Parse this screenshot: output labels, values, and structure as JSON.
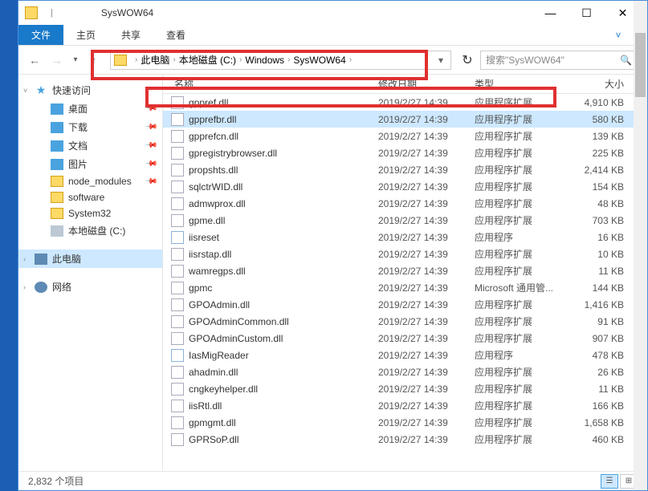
{
  "window": {
    "title": "SysWOW64",
    "min": "—",
    "max": "☐",
    "close": "✕"
  },
  "ribbon": {
    "file": "文件",
    "home": "主页",
    "share": "共享",
    "view": "查看",
    "help": "?"
  },
  "nav": {
    "back": "←",
    "forward": "→",
    "recent": "▾",
    "up": "↑",
    "refresh": "↻",
    "dropdown": "▾"
  },
  "breadcrumbs": [
    {
      "label": "此电脑"
    },
    {
      "label": "本地磁盘 (C:)"
    },
    {
      "label": "Windows"
    },
    {
      "label": "SysWOW64"
    }
  ],
  "search": {
    "placeholder": "搜索\"SysWOW64\"",
    "icon": "🔍"
  },
  "sidebar": {
    "quick": "快速访问",
    "items": [
      {
        "label": "桌面",
        "icon": "blue",
        "pin": true
      },
      {
        "label": "下载",
        "icon": "blue",
        "pin": true
      },
      {
        "label": "文档",
        "icon": "blue",
        "pin": true
      },
      {
        "label": "图片",
        "icon": "blue",
        "pin": true
      },
      {
        "label": "node_modules",
        "icon": "folder",
        "pin": true
      },
      {
        "label": "software",
        "icon": "folder"
      },
      {
        "label": "System32",
        "icon": "folder"
      },
      {
        "label": "本地磁盘 (C:)",
        "icon": "drive"
      }
    ],
    "thispc": "此电脑",
    "network": "网络"
  },
  "columns": {
    "name": "名称",
    "date": "修改日期",
    "type": "类型",
    "size": "大小"
  },
  "files": [
    {
      "name": "gppref.dll",
      "date": "2019/2/27 14:39",
      "type": "应用程序扩展",
      "size": "4,910 KB",
      "icon": "dll"
    },
    {
      "name": "gpprefbr.dll",
      "date": "2019/2/27 14:39",
      "type": "应用程序扩展",
      "size": "580 KB",
      "icon": "dll",
      "selected": true
    },
    {
      "name": "gpprefcn.dll",
      "date": "2019/2/27 14:39",
      "type": "应用程序扩展",
      "size": "139 KB",
      "icon": "dll"
    },
    {
      "name": "gpregistrybrowser.dll",
      "date": "2019/2/27 14:39",
      "type": "应用程序扩展",
      "size": "225 KB",
      "icon": "dll"
    },
    {
      "name": "propshts.dll",
      "date": "2019/2/27 14:39",
      "type": "应用程序扩展",
      "size": "2,414 KB",
      "icon": "dll"
    },
    {
      "name": "sqlctrWID.dll",
      "date": "2019/2/27 14:39",
      "type": "应用程序扩展",
      "size": "154 KB",
      "icon": "dll"
    },
    {
      "name": "admwprox.dll",
      "date": "2019/2/27 14:39",
      "type": "应用程序扩展",
      "size": "48 KB",
      "icon": "dll"
    },
    {
      "name": "gpme.dll",
      "date": "2019/2/27 14:39",
      "type": "应用程序扩展",
      "size": "703 KB",
      "icon": "dll"
    },
    {
      "name": "iisreset",
      "date": "2019/2/27 14:39",
      "type": "应用程序",
      "size": "16 KB",
      "icon": "exe"
    },
    {
      "name": "iisrstap.dll",
      "date": "2019/2/27 14:39",
      "type": "应用程序扩展",
      "size": "10 KB",
      "icon": "dll"
    },
    {
      "name": "wamregps.dll",
      "date": "2019/2/27 14:39",
      "type": "应用程序扩展",
      "size": "11 KB",
      "icon": "dll"
    },
    {
      "name": "gpmc",
      "date": "2019/2/27 14:39",
      "type": "Microsoft 通用管...",
      "size": "144 KB",
      "icon": "mmc"
    },
    {
      "name": "GPOAdmin.dll",
      "date": "2019/2/27 14:39",
      "type": "应用程序扩展",
      "size": "1,416 KB",
      "icon": "dll"
    },
    {
      "name": "GPOAdminCommon.dll",
      "date": "2019/2/27 14:39",
      "type": "应用程序扩展",
      "size": "91 KB",
      "icon": "dll"
    },
    {
      "name": "GPOAdminCustom.dll",
      "date": "2019/2/27 14:39",
      "type": "应用程序扩展",
      "size": "907 KB",
      "icon": "dll"
    },
    {
      "name": "IasMigReader",
      "date": "2019/2/27 14:39",
      "type": "应用程序",
      "size": "478 KB",
      "icon": "exe"
    },
    {
      "name": "ahadmin.dll",
      "date": "2019/2/27 14:39",
      "type": "应用程序扩展",
      "size": "26 KB",
      "icon": "dll"
    },
    {
      "name": "cngkeyhelper.dll",
      "date": "2019/2/27 14:39",
      "type": "应用程序扩展",
      "size": "11 KB",
      "icon": "dll"
    },
    {
      "name": "iisRtl.dll",
      "date": "2019/2/27 14:39",
      "type": "应用程序扩展",
      "size": "166 KB",
      "icon": "dll"
    },
    {
      "name": "gpmgmt.dll",
      "date": "2019/2/27 14:39",
      "type": "应用程序扩展",
      "size": "1,658 KB",
      "icon": "dll"
    },
    {
      "name": "GPRSoP.dll",
      "date": "2019/2/27 14:39",
      "type": "应用程序扩展",
      "size": "460 KB",
      "icon": "dll"
    }
  ],
  "status": {
    "count": "2,832 个项目"
  }
}
